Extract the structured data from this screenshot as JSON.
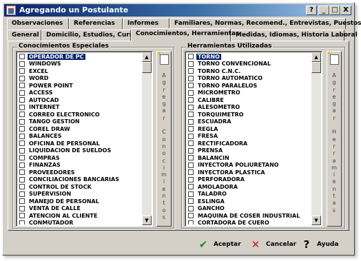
{
  "window": {
    "title": "Agregando un Postulante",
    "buttons": {
      "help": "?",
      "minimize": "_",
      "maximize": "□",
      "close": "X"
    }
  },
  "tabs": {
    "row1": [
      "Observaciones",
      "Referencias",
      "Informes",
      "Familiares, Normas, Recomend., Entrevistas, Puestos"
    ],
    "row2": [
      "General",
      "Domicilio, Estudios, Cursos",
      "Conocimientos, Herramientas",
      "Medidas, Idiomas, Historia Laboral"
    ],
    "active": "Conocimientos, Herramientas"
  },
  "conocimientos": {
    "title": "Conocimientos Especiales",
    "selected_index": 0,
    "items": [
      "OPERADOR DE PC",
      "WINDOWS",
      "EXCEL",
      "WORD",
      "POWER POINT",
      "ACCESS",
      "AUTOCAD",
      "INTERNET",
      "CORREO ELECTRONICO",
      "TANGO GESTION",
      "COREL DRAW",
      "BALANCES",
      "OFICINA DE PERSONAL",
      "LIQUIDACION DE SUELDOS",
      "COMPRAS",
      "FINANZAS",
      "PROVEEDORES",
      "CONCILIACIONES BANCARIAS",
      "CONTROL DE STOCK",
      "SUPERVISION",
      "MANEJO DE PERSONAL",
      "VENTA DE CALLE",
      "ATENCION AL CLIENTE",
      "CONMUTADOR"
    ],
    "add_label": "Agregar Conocimientos"
  },
  "herramientas": {
    "title": "Herramientas Utilizadas",
    "selected_index": 0,
    "items": [
      "TORNO",
      "TORNO CONVENCIONAL",
      "TORNO C.N.C.",
      "TORNO AUTOMATICO",
      "TORNO PARALELOS",
      "MICROMETRO",
      "CALIBRE",
      "ALESOMETRO",
      "TORQUIMETRO",
      "ESCUADRA",
      "REGLA",
      "FRESA",
      "RECTIFICADORA",
      "PRENSA",
      "BALANCIN",
      "INYECTORA POLIURETANO",
      "INYECTORA PLASTICA",
      "PERFORADORA",
      "AMOLADORA",
      "TALADRO",
      "ESLINGA",
      "GANCHO",
      "MAQUINA DE COSER INDUSTRIAL",
      "CORTADORA DE CUERO"
    ],
    "add_label": "Agregar Herramientas"
  },
  "actions": {
    "accept": "Aceptar",
    "cancel": "Cancelar",
    "help": "Ayuda"
  },
  "colors": {
    "titlebar_start": "#0a246a",
    "titlebar_end": "#a6caf0",
    "selection": "#0a246a",
    "face": "#d4d0c8"
  }
}
